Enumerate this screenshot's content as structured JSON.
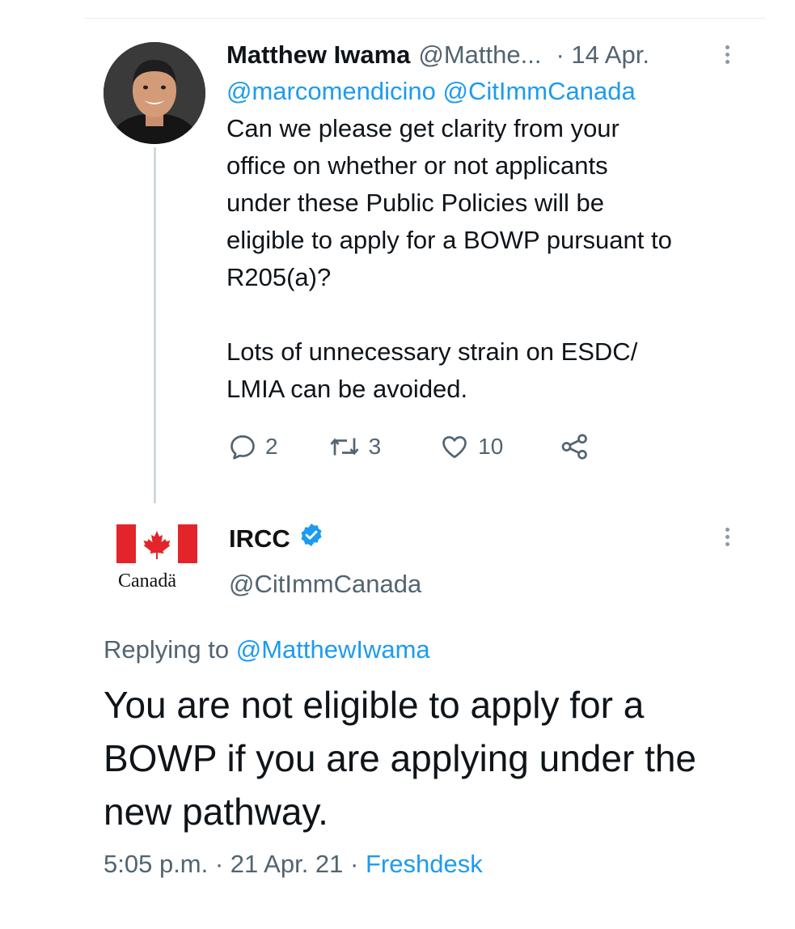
{
  "tweet1": {
    "author_name": "Matthew Iwama",
    "author_handle": "@Matthe...",
    "date": "· 14 Apr.",
    "mentions": "@marcomendicino @CitImmCanada",
    "body": "Can we please get clarity from your\noffice on whether or not applicants\nunder these Public Policies will be\neligible to apply for a BOWP pursuant to\nR205(a)?\n\nLots of unnecessary strain on ESDC/\nLMIA can be avoided.",
    "reply_count": "2",
    "retweet_count": "3",
    "like_count": "10",
    "icons": [
      "reply-icon",
      "retweet-icon",
      "like-icon",
      "share-icon",
      "more-icon"
    ]
  },
  "tweet2": {
    "logo_text": "Canadä",
    "author_name": "IRCC",
    "author_handle": "@CitImmCanada",
    "replying_prefix": "Replying to",
    "replying_handle": "@MatthewIwama",
    "body": "You are not eligible to apply for a BOWP if you are applying under the new pathway.",
    "time": "5:05 p.m. · 21 Apr. 21 ·",
    "source": "Freshdesk",
    "icons": [
      "verified-icon",
      "more-icon",
      "canada-flag-icon"
    ]
  },
  "colors": {
    "link": "#1d9bf0",
    "secondary_text": "#536471",
    "flag_red": "#e3252b"
  }
}
